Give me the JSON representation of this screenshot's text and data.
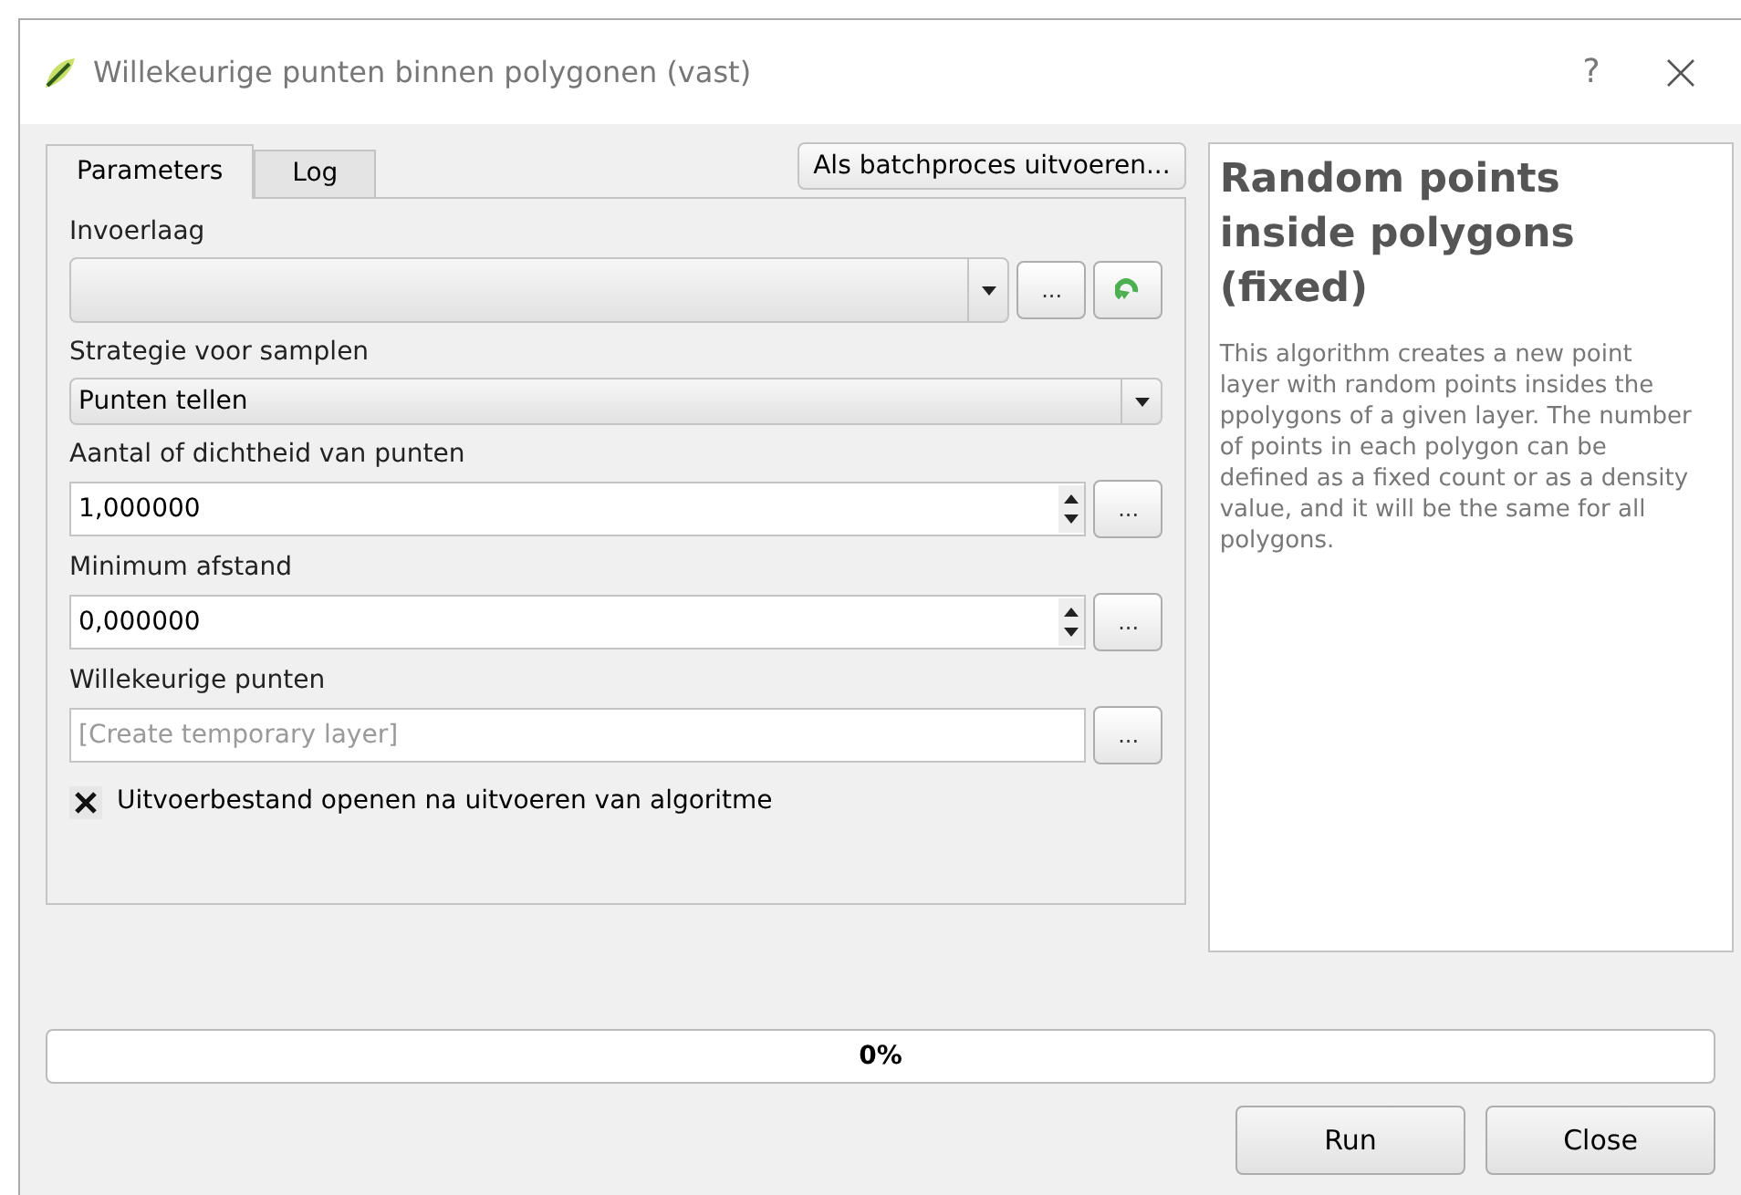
{
  "window": {
    "title": "Willekeurige punten binnen polygonen (vast)",
    "help": "?"
  },
  "tabs": [
    {
      "label": "Parameters",
      "selected": true
    },
    {
      "label": "Log",
      "selected": false
    }
  ],
  "batch_button": "Als batchproces uitvoeren...",
  "parameters": [
    {
      "kind": "layer",
      "label": "Invoerlaag",
      "browse": "..."
    },
    {
      "kind": "combo",
      "label": "Strategie voor samplen",
      "value": "Punten tellen"
    },
    {
      "kind": "spin",
      "label": "Aantal of dichtheid van punten",
      "value": "1,000000",
      "browse": "..."
    },
    {
      "kind": "spin",
      "label": "Minimum afstand",
      "value": "0,000000",
      "browse": "..."
    },
    {
      "kind": "file",
      "label": "Willekeurige punten",
      "placeholder": "[Create temporary layer]",
      "browse": "..."
    }
  ],
  "open_output": {
    "label": "Uitvoerbestand openen na uitvoeren van algoritme",
    "checked": true
  },
  "help_panel": {
    "title": "Random points inside polygons (fixed)",
    "text": "This algorithm creates a new point layer with random points insides the ppolygons of a given layer. The number of points in each polygon can be defined as a fixed count or as a density value, and it will be the same for all polygons."
  },
  "progress": {
    "level": 0,
    "reading": "0%"
  },
  "buttons": [
    {
      "label": "Run"
    },
    {
      "label": "Close"
    }
  ]
}
